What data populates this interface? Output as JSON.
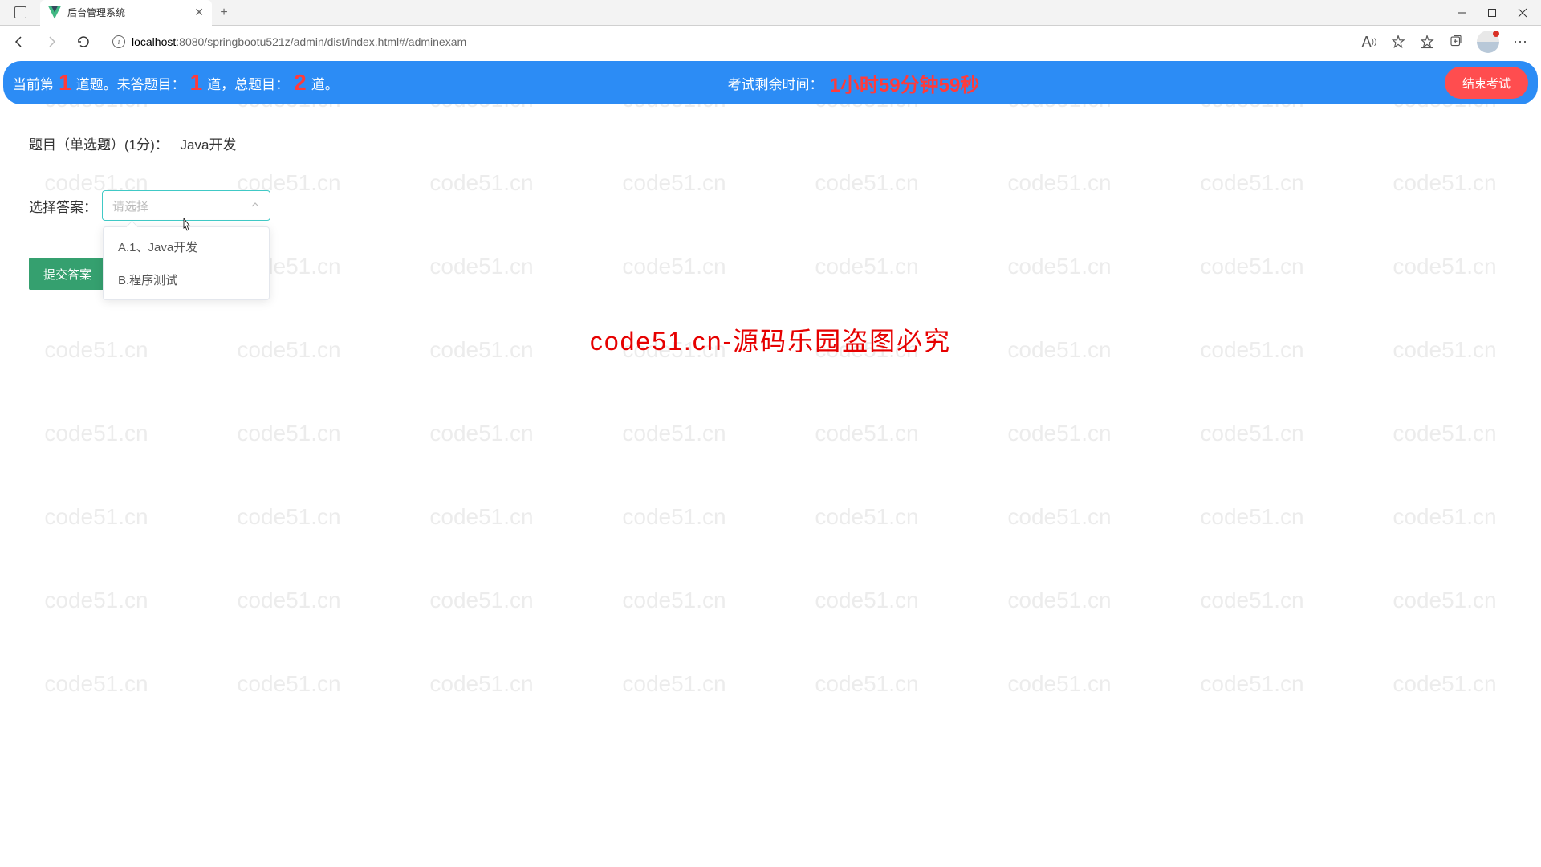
{
  "browser": {
    "tab_title": "后台管理系统",
    "url_host": "localhost",
    "url_path": ":8080/springbootu521z/admin/dist/index.html#/adminexam"
  },
  "header": {
    "prefix1": "当前第",
    "current_q": "1",
    "suffix1": "道题。未答题目：",
    "unanswered": "1",
    "suffix2": "道，总题目：",
    "total": "2",
    "suffix3": "道。",
    "timer_label": "考试剩余时间：",
    "timer_value": "1小时59分钟59秒",
    "end_exam": "结束考试"
  },
  "question": {
    "meta": "题目（单选题）(1分)：",
    "text": "Java开发"
  },
  "answer": {
    "label": "选择答案：",
    "placeholder": "请选择",
    "options": [
      "A.1、Java开发",
      "B.程序测试"
    ]
  },
  "submit_label": "提交答案",
  "watermark_text": "code51.cn",
  "copyright_text": "code51.cn-源码乐园盗图必究"
}
